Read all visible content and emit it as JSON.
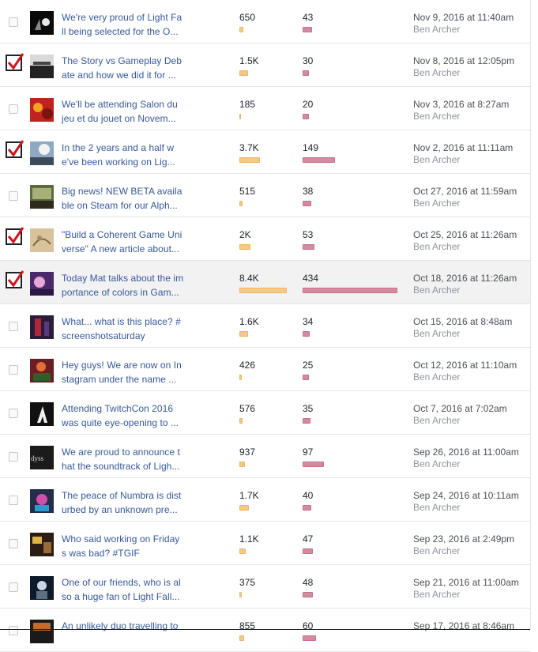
{
  "colors": {
    "reach_bar": "#f8c983",
    "engagement_bar": "#d58aa0",
    "link": "#365899"
  },
  "posts": [
    {
      "line1": "We're very proud of Light Fa",
      "line2": "ll being selected for the O...",
      "reach": "650",
      "reach_value": 650,
      "engagement": "43",
      "engagement_value": 43,
      "date": "Nov 9, 2016 at 11:40am",
      "author": "Ben Archer",
      "checked": false,
      "thumb": "logo-image"
    },
    {
      "line1": "The Story vs Gameplay Deb",
      "line2": "ate and how we did it for ...",
      "reach": "1.5K",
      "reach_value": 1500,
      "engagement": "30",
      "engagement_value": 30,
      "date": "Nov 8, 2016 at 12:05pm",
      "author": "Ben Archer",
      "checked": true,
      "thumb": "talk-image"
    },
    {
      "line1": "We'll be attending Salon du",
      "line2": "jeu et du jouet on Novem...",
      "reach": "185",
      "reach_value": 185,
      "engagement": "20",
      "engagement_value": 20,
      "date": "Nov 3, 2016 at 8:27am",
      "author": "Ben Archer",
      "checked": false,
      "thumb": "salon-image"
    },
    {
      "line1": "In the 2 years and a half w",
      "line2": "e've been working on Lig...",
      "reach": "3.7K",
      "reach_value": 3700,
      "engagement": "149",
      "engagement_value": 149,
      "date": "Nov 2, 2016 at 11:11am",
      "author": "Ben Archer",
      "checked": true,
      "thumb": "sky-image"
    },
    {
      "line1": "Big news! NEW BETA availa",
      "line2": "ble on Steam for our Alph...",
      "reach": "515",
      "reach_value": 515,
      "engagement": "38",
      "engagement_value": 38,
      "date": "Oct 27, 2016 at 11:59am",
      "author": "Ben Archer",
      "checked": false,
      "thumb": "beta-image"
    },
    {
      "line1": "\"Build a Coherent Game Uni",
      "line2": "verse\" A new article about...",
      "reach": "2K",
      "reach_value": 2000,
      "engagement": "53",
      "engagement_value": 53,
      "date": "Oct 25, 2016 at 11:26am",
      "author": "Ben Archer",
      "checked": true,
      "thumb": "sketch-image"
    },
    {
      "line1": "Today Mat talks about the im",
      "line2": "portance of colors in Gam...",
      "reach": "8.4K",
      "reach_value": 8400,
      "engagement": "434",
      "engagement_value": 434,
      "date": "Oct 18, 2016 at 11:26am",
      "author": "Ben Archer",
      "checked": true,
      "thumb": "colors-image"
    },
    {
      "line1": "What... what is this place? #",
      "line2": "screenshotsaturday",
      "reach": "1.6K",
      "reach_value": 1600,
      "engagement": "34",
      "engagement_value": 34,
      "date": "Oct 15, 2016 at 8:48am",
      "author": "Ben Archer",
      "checked": false,
      "thumb": "place-image"
    },
    {
      "line1": "Hey guys! We are now on In",
      "line2": "stagram under the name ...",
      "reach": "426",
      "reach_value": 426,
      "engagement": "25",
      "engagement_value": 25,
      "date": "Oct 12, 2016 at 11:10am",
      "author": "Ben Archer",
      "checked": false,
      "thumb": "instagram-image"
    },
    {
      "line1": "Attending TwitchCon 2016",
      "line2": "was quite eye-opening to ...",
      "reach": "576",
      "reach_value": 576,
      "engagement": "35",
      "engagement_value": 35,
      "date": "Oct 7, 2016 at 7:02am",
      "author": "Ben Archer",
      "checked": false,
      "thumb": "twitchcon-image"
    },
    {
      "line1": "We are proud to announce t",
      "line2": "hat the soundtrack of Ligh...",
      "reach": "937",
      "reach_value": 937,
      "engagement": "97",
      "engagement_value": 97,
      "date": "Sep 26, 2016 at 11:00am",
      "author": "Ben Archer",
      "checked": false,
      "thumb": "soundtrack-image"
    },
    {
      "line1": "The peace of Numbra is dist",
      "line2": "urbed by an unknown pre...",
      "reach": "1.7K",
      "reach_value": 1700,
      "engagement": "40",
      "engagement_value": 40,
      "date": "Sep 24, 2016 at 10:11am",
      "author": "Ben Archer",
      "checked": false,
      "thumb": "numbra-image"
    },
    {
      "line1": "Who said working on Friday",
      "line2": "s was bad? #TGIF",
      "reach": "1.1K",
      "reach_value": 1100,
      "engagement": "47",
      "engagement_value": 47,
      "date": "Sep 23, 2016 at 2:49pm",
      "author": "Ben Archer",
      "checked": false,
      "thumb": "friday-image"
    },
    {
      "line1": "One of our friends, who is al",
      "line2": "so a huge fan of Light Fall...",
      "reach": "375",
      "reach_value": 375,
      "engagement": "48",
      "engagement_value": 48,
      "date": "Sep 21, 2016 at 11:00am",
      "author": "Ben Archer",
      "checked": false,
      "thumb": "friend-image"
    },
    {
      "line1": "An unlikely duo travelling to",
      "line2": "",
      "reach": "855",
      "reach_value": 855,
      "engagement": "60",
      "engagement_value": 60,
      "date": "Sep 17, 2016 at 8:46am",
      "author": "",
      "checked": false,
      "thumb": "duo-image"
    }
  ]
}
